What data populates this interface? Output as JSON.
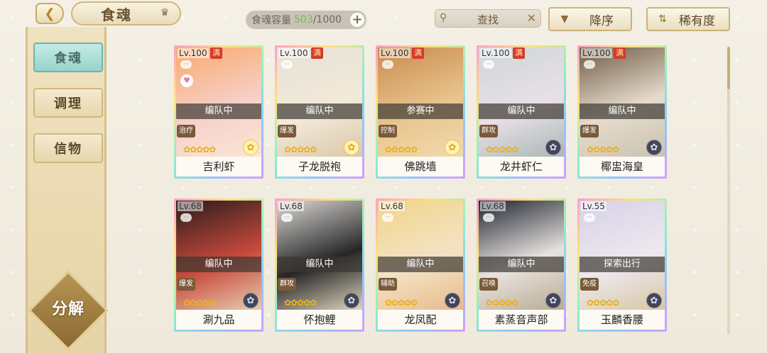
{
  "header": {
    "back_icon": "back-arrow-icon",
    "title": "食魂",
    "capacity_label": "食魂容量",
    "capacity_current": "503",
    "capacity_max": "/1000",
    "search_label": "查找",
    "sort_desc_label": "降序",
    "sort_rarity_label": "稀有度"
  },
  "sidebar": {
    "tabs": [
      {
        "label": "食魂",
        "active": true
      },
      {
        "label": "调理",
        "active": false
      },
      {
        "label": "信物",
        "active": false
      }
    ],
    "decompose_label": "分解"
  },
  "cards": [
    {
      "level": "Lv.100",
      "full": "满",
      "status": "编队中",
      "role": "治疗",
      "name": "吉利虾",
      "element": "gold",
      "colors": [
        "#f9a96b",
        "#f6d0c9",
        "#fbe7d6"
      ]
    },
    {
      "level": "Lv.100",
      "full": "满",
      "status": "编队中",
      "role": "爆发",
      "name": "子龙脱袍",
      "element": "gold",
      "colors": [
        "#e7e1d6",
        "#f2ead9",
        "#d9c6a7"
      ]
    },
    {
      "level": "Lv.100",
      "full": "满",
      "status": "参赛中",
      "role": "控制",
      "name": "佛跳墙",
      "element": "gold",
      "colors": [
        "#c98b4e",
        "#e8c48d",
        "#f1dcb0"
      ]
    },
    {
      "level": "Lv.100",
      "full": "满",
      "status": "编队中",
      "role": "群攻",
      "name": "龙井虾仁",
      "element": "dark",
      "colors": [
        "#cfd6d8",
        "#e8e0e6",
        "#a7b5b4"
      ]
    },
    {
      "level": "Lv.100",
      "full": "满",
      "status": "编队中",
      "role": "爆发",
      "name": "椰盅海皇",
      "element": "dark",
      "colors": [
        "#6e5a44",
        "#e6dccd",
        "#c8c0b0"
      ]
    },
    {
      "level": "Lv.68",
      "full": "",
      "status": "编队中",
      "role": "爆发",
      "name": "涮九品",
      "element": "dark",
      "colors": [
        "#2a1c1c",
        "#c94a3c",
        "#e6d2b6"
      ]
    },
    {
      "level": "Lv.68",
      "full": "",
      "status": "编队中",
      "role": "群攻",
      "name": "怀抱鲤",
      "element": "dark",
      "colors": [
        "#dcd9d6",
        "#262626",
        "#e8dcc5"
      ]
    },
    {
      "level": "Lv.68",
      "full": "",
      "status": "编队中",
      "role": "辅助",
      "name": "龙凤配",
      "element": "dark",
      "colors": [
        "#f2d48a",
        "#f3e3c4",
        "#e6b98b"
      ]
    },
    {
      "level": "Lv.68",
      "full": "",
      "status": "编队中",
      "role": "召唤",
      "name": "素蒸音声部",
      "element": "dark",
      "colors": [
        "#1e2430",
        "#e9e3df",
        "#b7a98e"
      ]
    },
    {
      "level": "Lv.55",
      "full": "",
      "status": "探索出行",
      "role": "免疫",
      "name": "玉麟香腰",
      "element": "dark",
      "colors": [
        "#d6d1e6",
        "#eee8ef",
        "#d6c6a0"
      ]
    }
  ],
  "stars": "✿✿✿✿✿"
}
